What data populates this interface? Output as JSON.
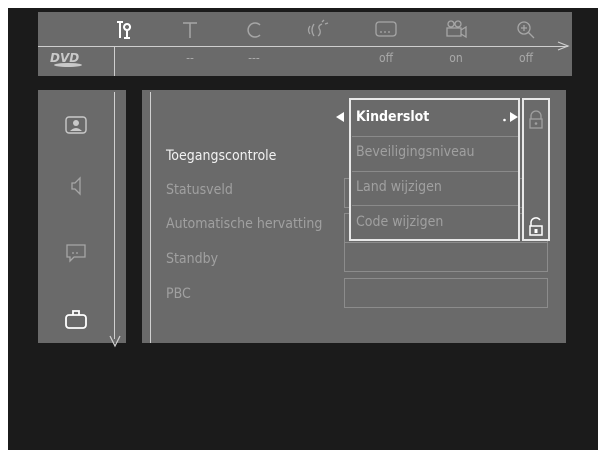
{
  "top_menu": {
    "icons": [
      "tools-icon",
      "title-icon",
      "chapter-icon",
      "audio-icon",
      "subtitle-icon",
      "camera-angle-icon",
      "zoom-icon"
    ],
    "values": [
      "--",
      "---",
      "off",
      "on",
      "off"
    ],
    "disc_logo": "DVD"
  },
  "side_menu": {
    "icons": [
      "picture-icon",
      "speaker-icon",
      "speech-bubble-icon",
      "briefcase-icon"
    ]
  },
  "settings": {
    "rows": [
      {
        "label": "Toegangscontrole",
        "active": true
      },
      {
        "label": "Statusveld"
      },
      {
        "label": "Automatische hervatting"
      },
      {
        "label": "Standby"
      },
      {
        "label": "PBC"
      }
    ]
  },
  "submenu": {
    "items": [
      "Kinderslot",
      "Beveiligingsniveau",
      "Land wijzigen",
      "Code wijzigen"
    ],
    "selected_index": 0,
    "lock_icons": [
      "lock-closed-icon",
      "lock-open-icon"
    ]
  }
}
